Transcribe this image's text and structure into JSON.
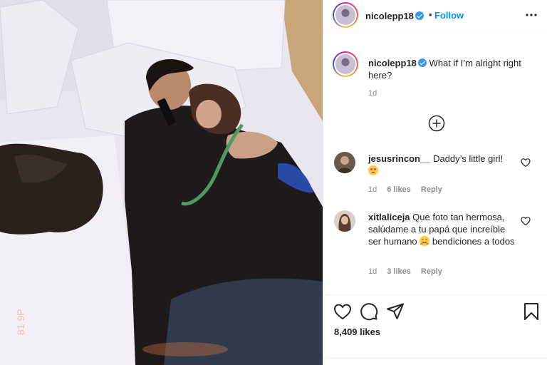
{
  "post": {
    "username": "nicolepp18",
    "verified": true,
    "separator": "•",
    "follow_label": "Follow",
    "more_icon": "more-horizontal-icon",
    "caption": "What if I’m alright right here?",
    "caption_time": "1d",
    "load_more_icon": "plus-circle-icon",
    "photo_watermark": "81 9P"
  },
  "comments": [
    {
      "username": "jesusrincon__",
      "text": "Daddy’s little girl!",
      "emoji": "heart-eyes-emoji",
      "time": "1d",
      "likes": "6 likes",
      "reply": "Reply"
    },
    {
      "username": "xitlaliceja",
      "text": "Que foto tan hermosa, salúdame a tu papá que increíble ser humano",
      "emoji": "smiling-hug-emoji",
      "text_after": "bendiciones a todos",
      "time": "1d",
      "likes": "3 likes",
      "reply": "Reply"
    }
  ],
  "actions": {
    "icons": [
      "heart-icon",
      "comment-icon",
      "share-icon",
      "bookmark-icon"
    ],
    "likes": "8,409 likes"
  },
  "colors": {
    "accent": "#0095f6",
    "verified": "#3897f0",
    "muted": "#8e8e8e",
    "text": "#262626"
  }
}
